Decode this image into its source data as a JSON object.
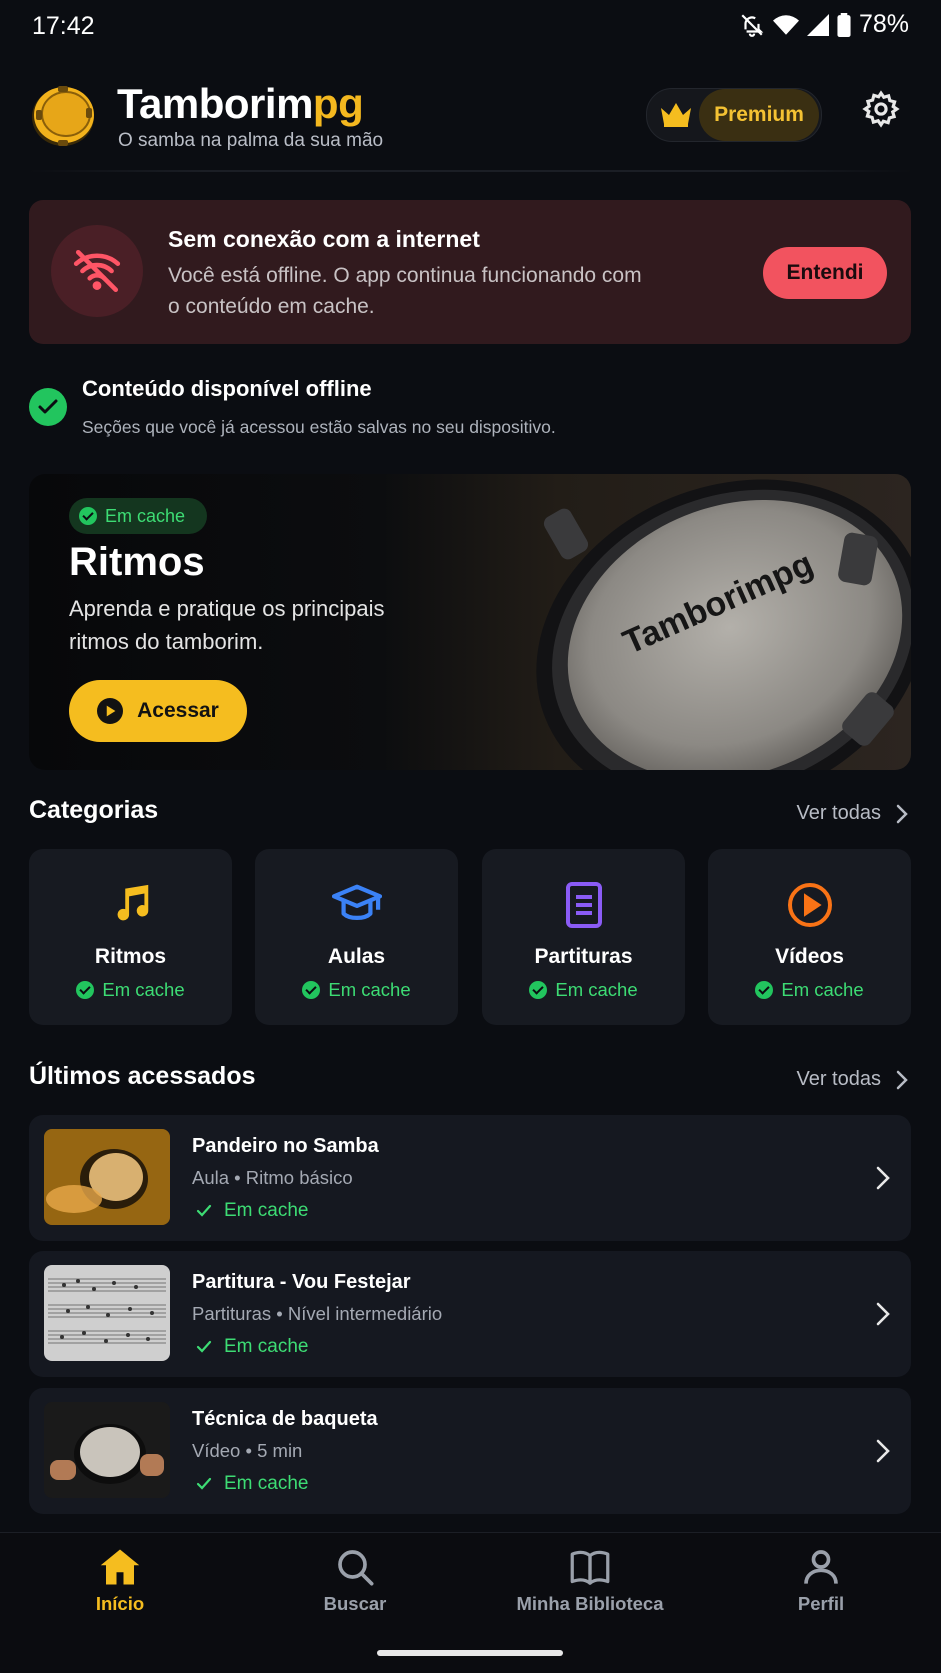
{
  "status_bar": {
    "time": "17:42",
    "battery": "78%"
  },
  "header": {
    "brand_main": "Tamborim",
    "brand_accent": "pg",
    "tagline": "O samba na palma da sua mão",
    "premium_label": "Premium",
    "accent_color": "#f5bd1f"
  },
  "offline_banner": {
    "title": "Sem conexão com a internet",
    "description": "Você está offline. O app continua funcionando com o conteúdo em cache.",
    "button": "Entendi",
    "icon": "wifi-off-icon"
  },
  "offline_status": {
    "title": "Conteúdo disponível offline",
    "description": "Seções que você já acessou estão salvas no seu dispositivo."
  },
  "hero": {
    "badge": "Em cache",
    "title": "Ritmos",
    "description": "Aprenda e pratique os principais ritmos do tamborim.",
    "button": "Acessar",
    "drum_text": "Tamborimpg"
  },
  "categories": {
    "title": "Categorias",
    "see_all": "Ver todas",
    "items": [
      {
        "name": "Ritmos",
        "status": "Em cache",
        "icon": "music-note-icon",
        "color": "#f5bd1f"
      },
      {
        "name": "Aulas",
        "status": "Em cache",
        "icon": "graduation-cap-icon",
        "color": "#3b82f6"
      },
      {
        "name": "Partituras",
        "status": "Em cache",
        "icon": "document-icon",
        "color": "#8b5cf6"
      },
      {
        "name": "Vídeos",
        "status": "Em cache",
        "icon": "play-circle-icon",
        "color": "#f97316"
      }
    ]
  },
  "recent": {
    "title": "Últimos acessados",
    "see_all": "Ver todas",
    "items": [
      {
        "title": "Pandeiro no Samba",
        "subtitle": "Aula • Ritmo básico",
        "status": "Em cache"
      },
      {
        "title": "Partitura - Vou Festejar",
        "subtitle": "Partituras • Nível intermediário",
        "status": "Em cache"
      },
      {
        "title": "Técnica de baqueta",
        "subtitle": "Vídeo • 5 min",
        "status": "Em cache"
      }
    ]
  },
  "bottom_nav": [
    {
      "label": "Início",
      "icon": "home-icon",
      "active": true
    },
    {
      "label": "Buscar",
      "icon": "search-icon",
      "active": false
    },
    {
      "label": "Minha Biblioteca",
      "icon": "book-open-icon",
      "active": false
    },
    {
      "label": "Perfil",
      "icon": "user-icon",
      "active": false
    }
  ]
}
